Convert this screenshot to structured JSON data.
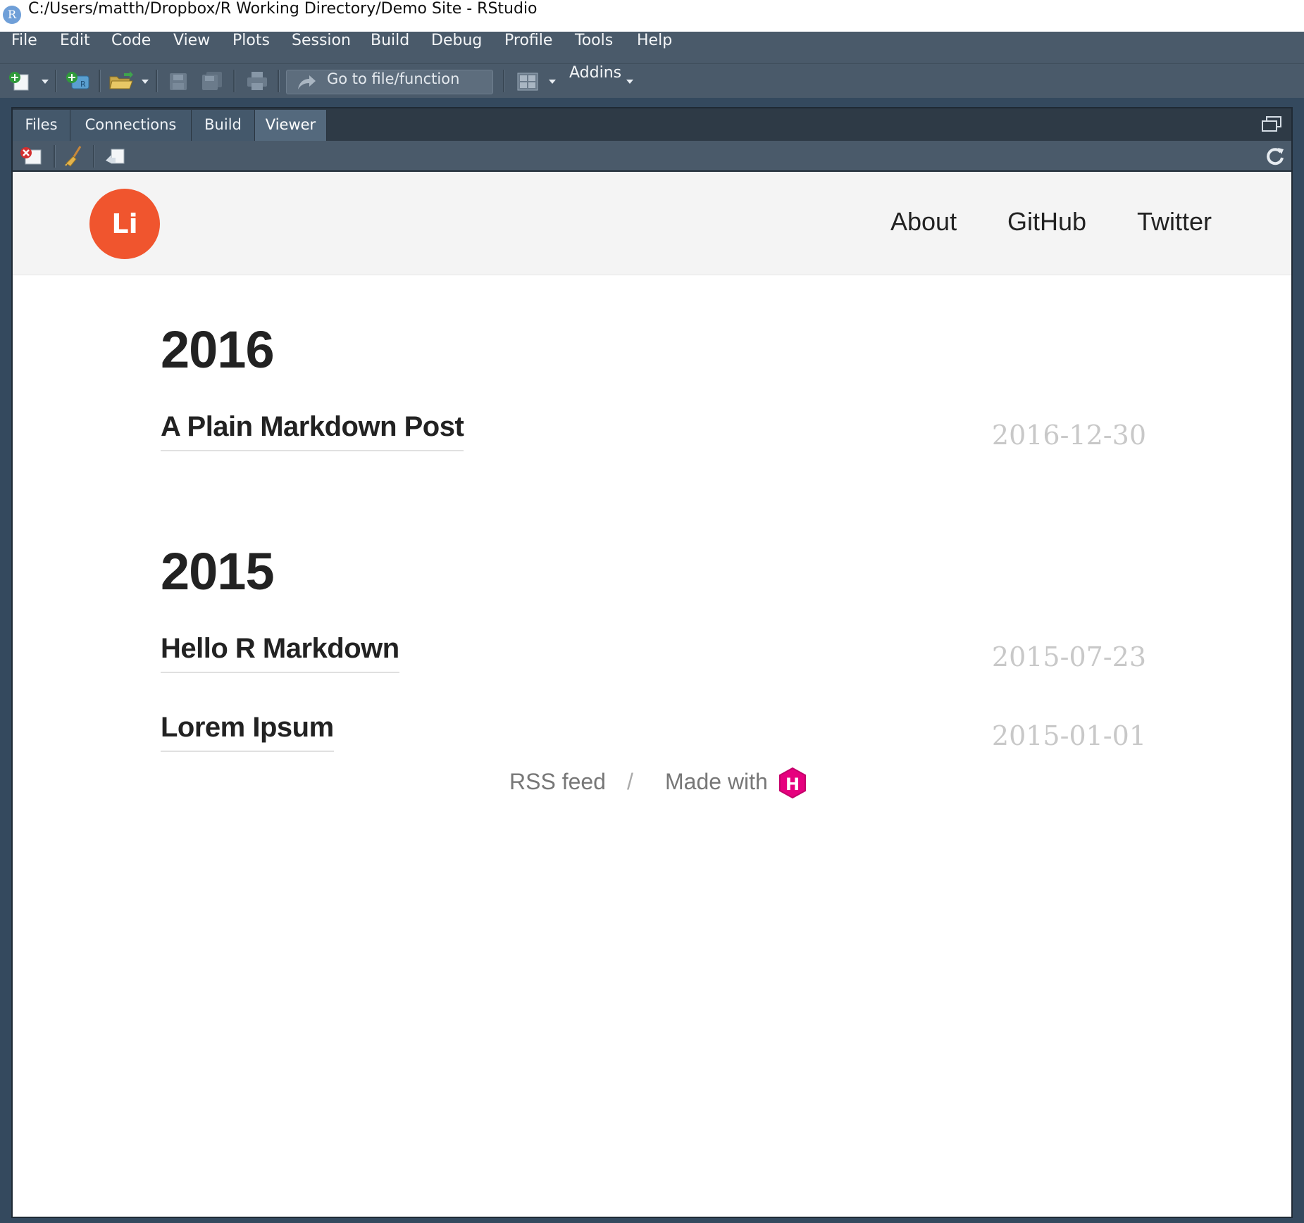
{
  "window": {
    "title": "C:/Users/matth/Dropbox/R Working Directory/Demo Site - RStudio",
    "app_icon_letter": "R"
  },
  "menu": [
    "File",
    "Edit",
    "Code",
    "View",
    "Plots",
    "Session",
    "Build",
    "Debug",
    "Profile",
    "Tools",
    "Help"
  ],
  "toolbar": {
    "goto_placeholder": "Go to file/function",
    "addins_label": "Addins"
  },
  "pane": {
    "tabs": [
      "Files",
      "Connections",
      "Build",
      "Viewer"
    ],
    "active_tab": "Viewer"
  },
  "site": {
    "logo_text": "Li",
    "nav": [
      "About",
      "GitHub",
      "Twitter"
    ],
    "years": [
      {
        "year": "2016",
        "posts": [
          {
            "title": "A Plain Markdown Post",
            "date": "2016-12-30"
          }
        ]
      },
      {
        "year": "2015",
        "posts": [
          {
            "title": "Hello R Markdown",
            "date": "2015-07-23"
          },
          {
            "title": "Lorem Ipsum",
            "date": "2015-01-01"
          }
        ]
      }
    ],
    "footer": {
      "rss": "RSS feed",
      "separator": "/",
      "made_with": "Made with",
      "hugo_badge": "H"
    }
  },
  "colors": {
    "logo": "#f0552e",
    "hugo_badge": "#e6007e",
    "chrome": "#4a5a6a",
    "date": "#c8c8c8"
  },
  "icons": [
    "new-file-icon",
    "new-project-icon",
    "open-folder-icon",
    "save-icon",
    "save-all-icon",
    "print-icon",
    "goto-arrow-icon",
    "grid-layout-icon",
    "clear-viewer-icon",
    "broom-icon",
    "export-icon",
    "refresh-icon",
    "maximize-icon"
  ]
}
